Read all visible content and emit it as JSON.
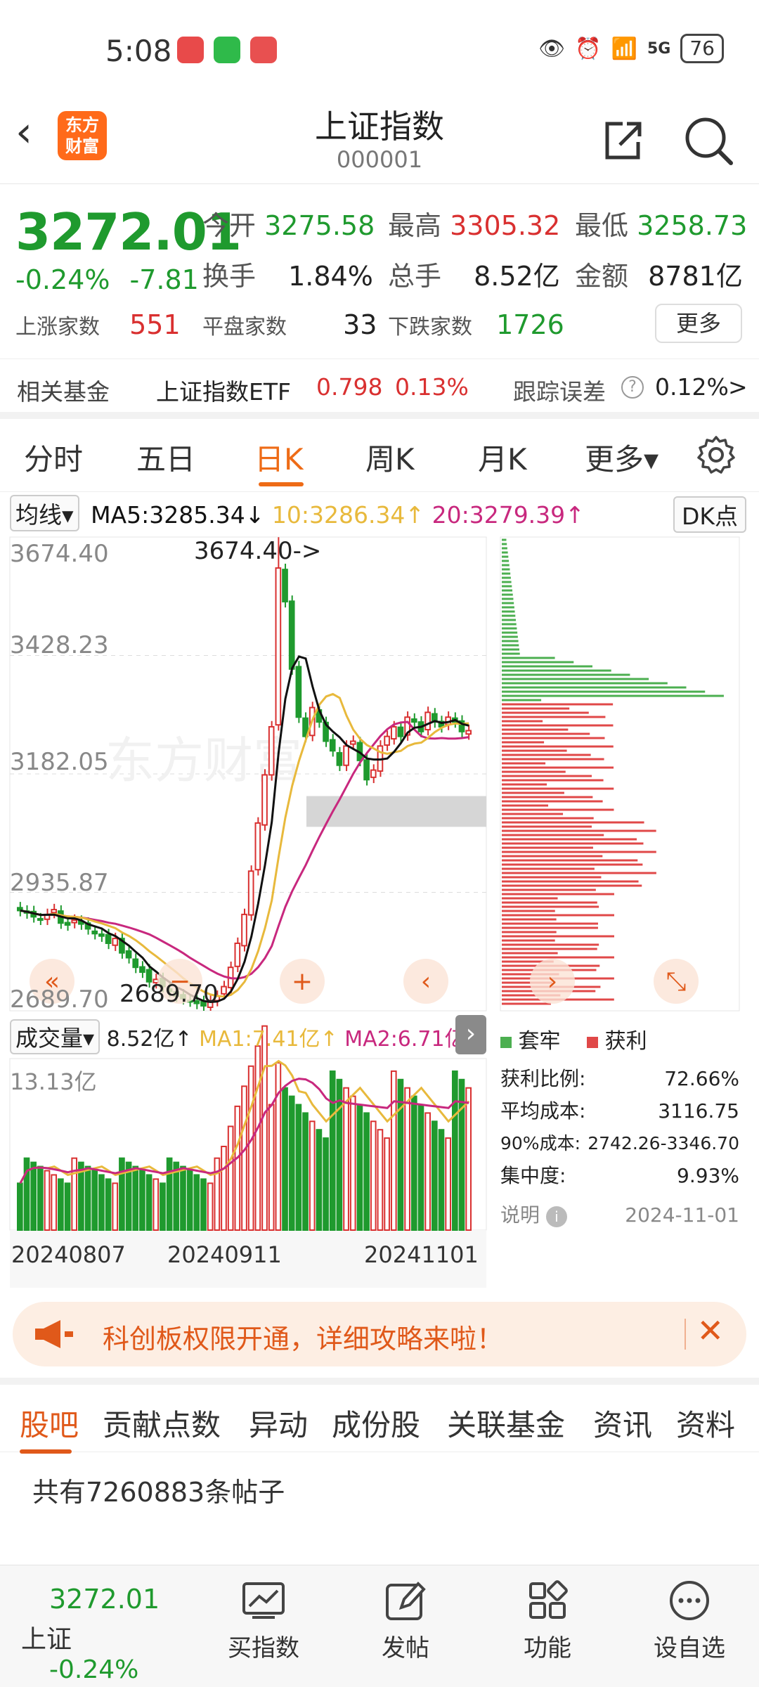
{
  "status": {
    "time": "5:08",
    "network": "5G",
    "battery": "76"
  },
  "nav": {
    "title": "上证指数",
    "code": "000001"
  },
  "quote": {
    "price": "3272.01",
    "pct": "-0.24%",
    "change": "-7.81",
    "open_label": "今开",
    "open": "3275.58",
    "high_label": "最高",
    "high": "3305.32",
    "low_label": "最低",
    "low": "3258.73",
    "turnover_label": "换手",
    "turnover": "1.84%",
    "volume_label": "总手",
    "volume": "8.52亿",
    "amount_label": "金额",
    "amount": "8781亿",
    "up_label": "上涨家数",
    "up": "551",
    "flat_label": "平盘家数",
    "flat": "33",
    "down_label": "下跌家数",
    "down": "1726",
    "more": "更多"
  },
  "fund": {
    "label": "相关基金",
    "name": "上证指数ETF",
    "price": "0.798",
    "pct": "0.13%",
    "err_label": "跟踪误差",
    "err": "0.12%",
    "arrow": ">"
  },
  "tabs": [
    "分时",
    "五日",
    "日K",
    "周K",
    "月K",
    "更多▾"
  ],
  "ma": {
    "selector": "均线▾",
    "ma5": "MA5:3285.34↓",
    "ma10": "10:3286.34↑",
    "ma20": "20:3279.39↑",
    "dk": "DK点"
  },
  "colors": {
    "up": "#d93030",
    "down": "#1f9a2e",
    "ma5": "#111111",
    "ma10": "#e8b93c",
    "ma20": "#c8287e",
    "accent": "#ee6b16"
  },
  "chart_data": [
    {
      "type": "candlestick",
      "y_ticks": [
        "3674.40",
        "3428.23",
        "3182.05",
        "2935.87",
        "2689.70"
      ],
      "ylim": [
        2689.7,
        3674.4
      ],
      "max_label": "3674.40->",
      "min_label": "2689.70",
      "ma_lines": [
        "MA5",
        "MA10",
        "MA20"
      ],
      "closes": [
        2898,
        2893,
        2885,
        2880,
        2890,
        2900,
        2872,
        2868,
        2878,
        2870,
        2860,
        2850,
        2845,
        2830,
        2840,
        2810,
        2800,
        2780,
        2770,
        2750,
        2755,
        2740,
        2730,
        2720,
        2715,
        2710,
        2705,
        2700,
        2710,
        2720,
        2740,
        2780,
        2830,
        2890,
        2980,
        3080,
        3180,
        3280,
        3610,
        3540,
        3400,
        3300,
        3260,
        3320,
        3290,
        3250,
        3230,
        3200,
        3240,
        3250,
        3210,
        3170,
        3190,
        3240,
        3260,
        3280,
        3260,
        3300,
        3290,
        3270,
        3310,
        3290,
        3280,
        3300,
        3290,
        3270,
        3272.01
      ]
    },
    {
      "type": "volume_bar",
      "label": "成交量",
      "selector": "成交量▾",
      "vol": "8.52亿↑",
      "ma1": "MA1:7.41亿↑",
      "ma2": "MA2:6.71亿↑",
      "max": "13.13亿",
      "dates": [
        "20240807",
        "20240911",
        "20241101"
      ]
    },
    {
      "type": "chip_distribution",
      "legend": [
        {
          "name": "套牢",
          "color": "#4caf50"
        },
        {
          "name": "获利",
          "color": "#e04848"
        }
      ],
      "stats": [
        {
          "k": "获利比例:",
          "v": "72.66%"
        },
        {
          "k": "平均成本:",
          "v": "3116.75"
        },
        {
          "k": "90%成本:",
          "v": "2742.26-3346.70"
        },
        {
          "k": "集中度:",
          "v": "9.93%"
        }
      ],
      "note": "说明",
      "date": "2024-11-01"
    }
  ],
  "banner": {
    "text": "科创板权限开通，详细攻略来啦！"
  },
  "subtabs": [
    "股吧",
    "贡献点数",
    "异动",
    "成份股",
    "关联基金",
    "资讯",
    "资料"
  ],
  "posts": {
    "count_text": "共有7260883条帖子"
  },
  "bottom": {
    "price": "3272.01",
    "name": "上证",
    "pct": "-0.24%",
    "items": [
      "买指数",
      "发帖",
      "功能",
      "设自选"
    ]
  }
}
